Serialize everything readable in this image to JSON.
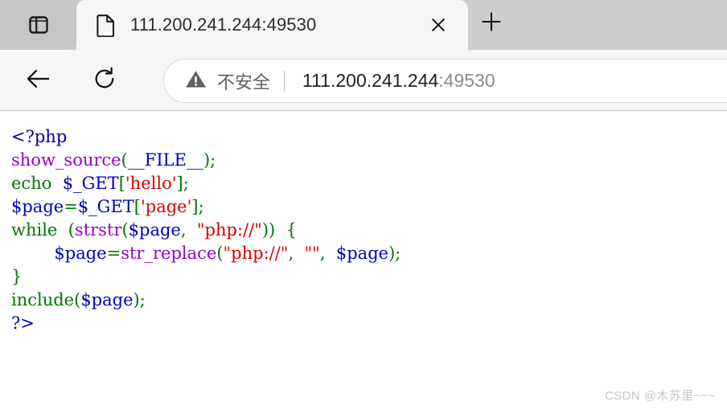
{
  "browser": {
    "tab_list_icon": "panel-list-icon",
    "tab": {
      "favicon": "document-icon",
      "title": "111.200.241.244:49530",
      "close_icon": "close-icon"
    },
    "new_tab": {
      "icon": "plus-icon",
      "label": "+"
    },
    "toolbar": {
      "back_icon": "back-arrow-icon",
      "reload_icon": "reload-icon"
    },
    "omnibox": {
      "security_icon": "warning-triangle-icon",
      "security_text": "不安全",
      "url_host": "111.200.241.244",
      "url_port": ":49530"
    }
  },
  "page": {
    "code_lines": [
      [
        {
          "text": "<?php",
          "cls": "t-php"
        }
      ],
      [
        {
          "text": "show_source",
          "cls": "t-fn"
        },
        {
          "text": "(",
          "cls": "t-punc"
        },
        {
          "text": "__FILE__",
          "cls": "t-var"
        },
        {
          "text": ")",
          "cls": "t-punc"
        },
        {
          "text": ";",
          "cls": "t-punc"
        }
      ],
      [
        {
          "text": "echo",
          "cls": "t-key"
        },
        {
          "text": "  ",
          "cls": "t-punc"
        },
        {
          "text": "$_GET",
          "cls": "t-var"
        },
        {
          "text": "[",
          "cls": "t-punc"
        },
        {
          "text": "'hello'",
          "cls": "t-str"
        },
        {
          "text": "]",
          "cls": "t-punc"
        },
        {
          "text": ";",
          "cls": "t-punc"
        }
      ],
      [
        {
          "text": "$page",
          "cls": "t-var"
        },
        {
          "text": "=",
          "cls": "t-punc"
        },
        {
          "text": "$_GET",
          "cls": "t-var"
        },
        {
          "text": "[",
          "cls": "t-punc"
        },
        {
          "text": "'page'",
          "cls": "t-str"
        },
        {
          "text": "]",
          "cls": "t-punc"
        },
        {
          "text": ";",
          "cls": "t-punc"
        }
      ],
      [
        {
          "text": "while",
          "cls": "t-key"
        },
        {
          "text": "  (",
          "cls": "t-punc"
        },
        {
          "text": "strstr",
          "cls": "t-fn"
        },
        {
          "text": "(",
          "cls": "t-punc"
        },
        {
          "text": "$page",
          "cls": "t-var"
        },
        {
          "text": ",  ",
          "cls": "t-punc"
        },
        {
          "text": "\"php://\"",
          "cls": "t-str"
        },
        {
          "text": "))",
          "cls": "t-punc"
        },
        {
          "text": "  {",
          "cls": "t-punc"
        }
      ],
      [
        {
          "text": "        ",
          "cls": "t-punc"
        },
        {
          "text": "$page",
          "cls": "t-var"
        },
        {
          "text": "=",
          "cls": "t-punc"
        },
        {
          "text": "str_replace",
          "cls": "t-fn"
        },
        {
          "text": "(",
          "cls": "t-punc"
        },
        {
          "text": "\"php://\"",
          "cls": "t-str"
        },
        {
          "text": ",  ",
          "cls": "t-punc"
        },
        {
          "text": "\"\"",
          "cls": "t-str"
        },
        {
          "text": ",  ",
          "cls": "t-punc"
        },
        {
          "text": "$page",
          "cls": "t-var"
        },
        {
          "text": ")",
          "cls": "t-punc"
        },
        {
          "text": ";",
          "cls": "t-punc"
        }
      ],
      [
        {
          "text": "}",
          "cls": "t-punc"
        }
      ],
      [
        {
          "text": "include",
          "cls": "t-key"
        },
        {
          "text": "(",
          "cls": "t-punc"
        },
        {
          "text": "$page",
          "cls": "t-var"
        },
        {
          "text": ")",
          "cls": "t-punc"
        },
        {
          "text": ";",
          "cls": "t-punc"
        }
      ],
      [
        {
          "text": "?>",
          "cls": "t-php"
        }
      ]
    ],
    "watermark": "CSDN @木苏里~~~"
  },
  "colors": {
    "php_delimiter": "#000099",
    "keyword": "#007700",
    "function": "#9900cc",
    "variable": "#0000bb",
    "string": "#dd0000",
    "punctuation": "#007700",
    "chrome_bg": "#cdcdcd",
    "toolbar_bg": "#f6f6f6",
    "page_bg": "#ffffff",
    "watermark": "#c9c9c9"
  }
}
